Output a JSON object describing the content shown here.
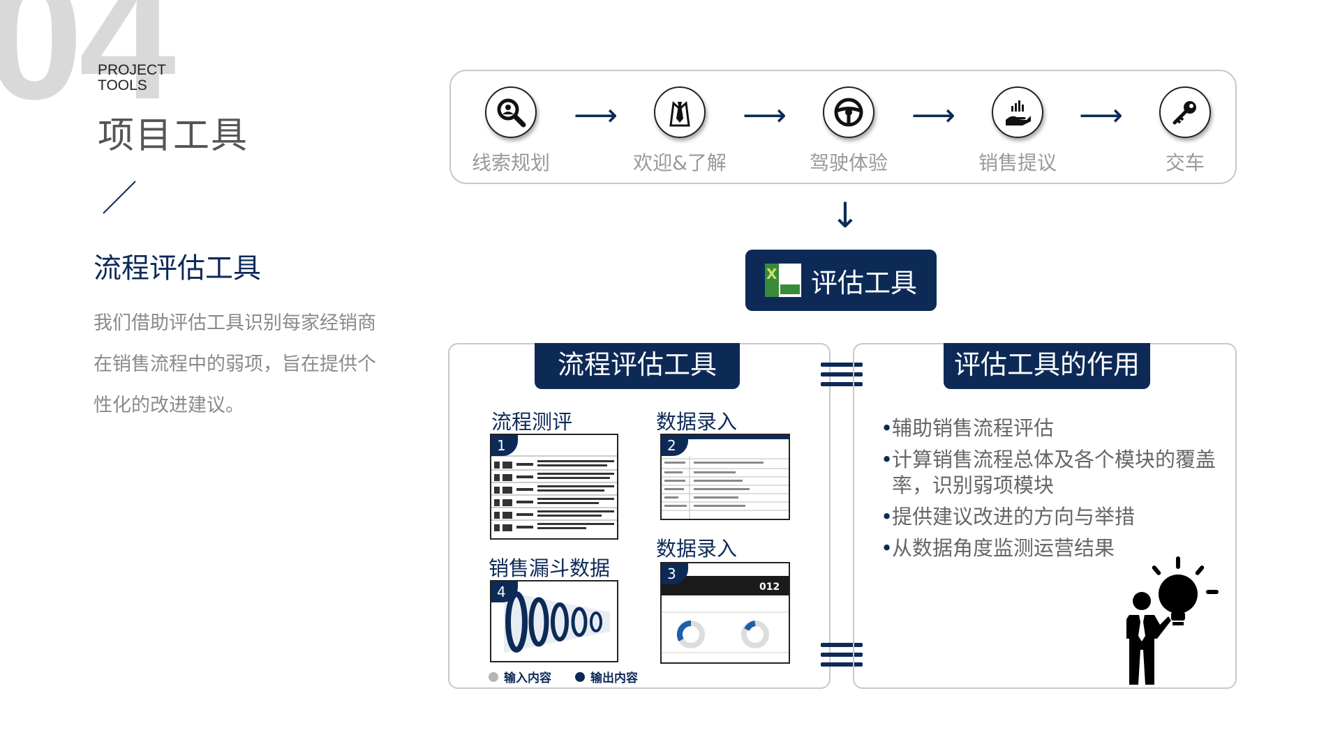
{
  "header": {
    "number": "04",
    "project_en_line1": "PROJECT",
    "project_en_line2": "TOOLS",
    "title": "项目工具"
  },
  "intro": {
    "subtitle": "流程评估工具",
    "description": "我们借助评估工具识别每家经销商在销售流程中的弱项，旨在提供个性化的改进建议。"
  },
  "process": {
    "steps": [
      {
        "label": "线索规划",
        "icon": "search-person-icon"
      },
      {
        "label": "欢迎&了解",
        "icon": "tie-person-icon"
      },
      {
        "label": "驾驶体验",
        "icon": "steering-wheel-icon"
      },
      {
        "label": "销售提议",
        "icon": "hand-chart-icon"
      },
      {
        "label": "交车",
        "icon": "key-icon"
      }
    ]
  },
  "eval_button": {
    "label": "评估工具",
    "icon": "excel-icon"
  },
  "left_panel": {
    "tab": "流程评估工具",
    "thumbs": [
      {
        "title": "流程测评",
        "num": "1"
      },
      {
        "title": "数据录入",
        "num": "2"
      },
      {
        "title": "数据录入",
        "num": "3"
      },
      {
        "title": "销售漏斗数据",
        "num": "4"
      }
    ],
    "thumb3_value": "012",
    "legend": {
      "input": "输入内容",
      "output": "输出内容"
    }
  },
  "right_panel": {
    "tab": "评估工具的作用",
    "bullets": [
      "辅助销售流程评估",
      "计算销售流程总体及各个模块的覆盖率，识别弱项模块",
      "提供建议改进的方向与举措",
      "从数据角度监测运营结果"
    ]
  },
  "colors": {
    "navy": "#0d2a57",
    "gray_text": "#8a8a8a",
    "light_gray": "#d9d9d9",
    "border": "#c8c8c8"
  }
}
